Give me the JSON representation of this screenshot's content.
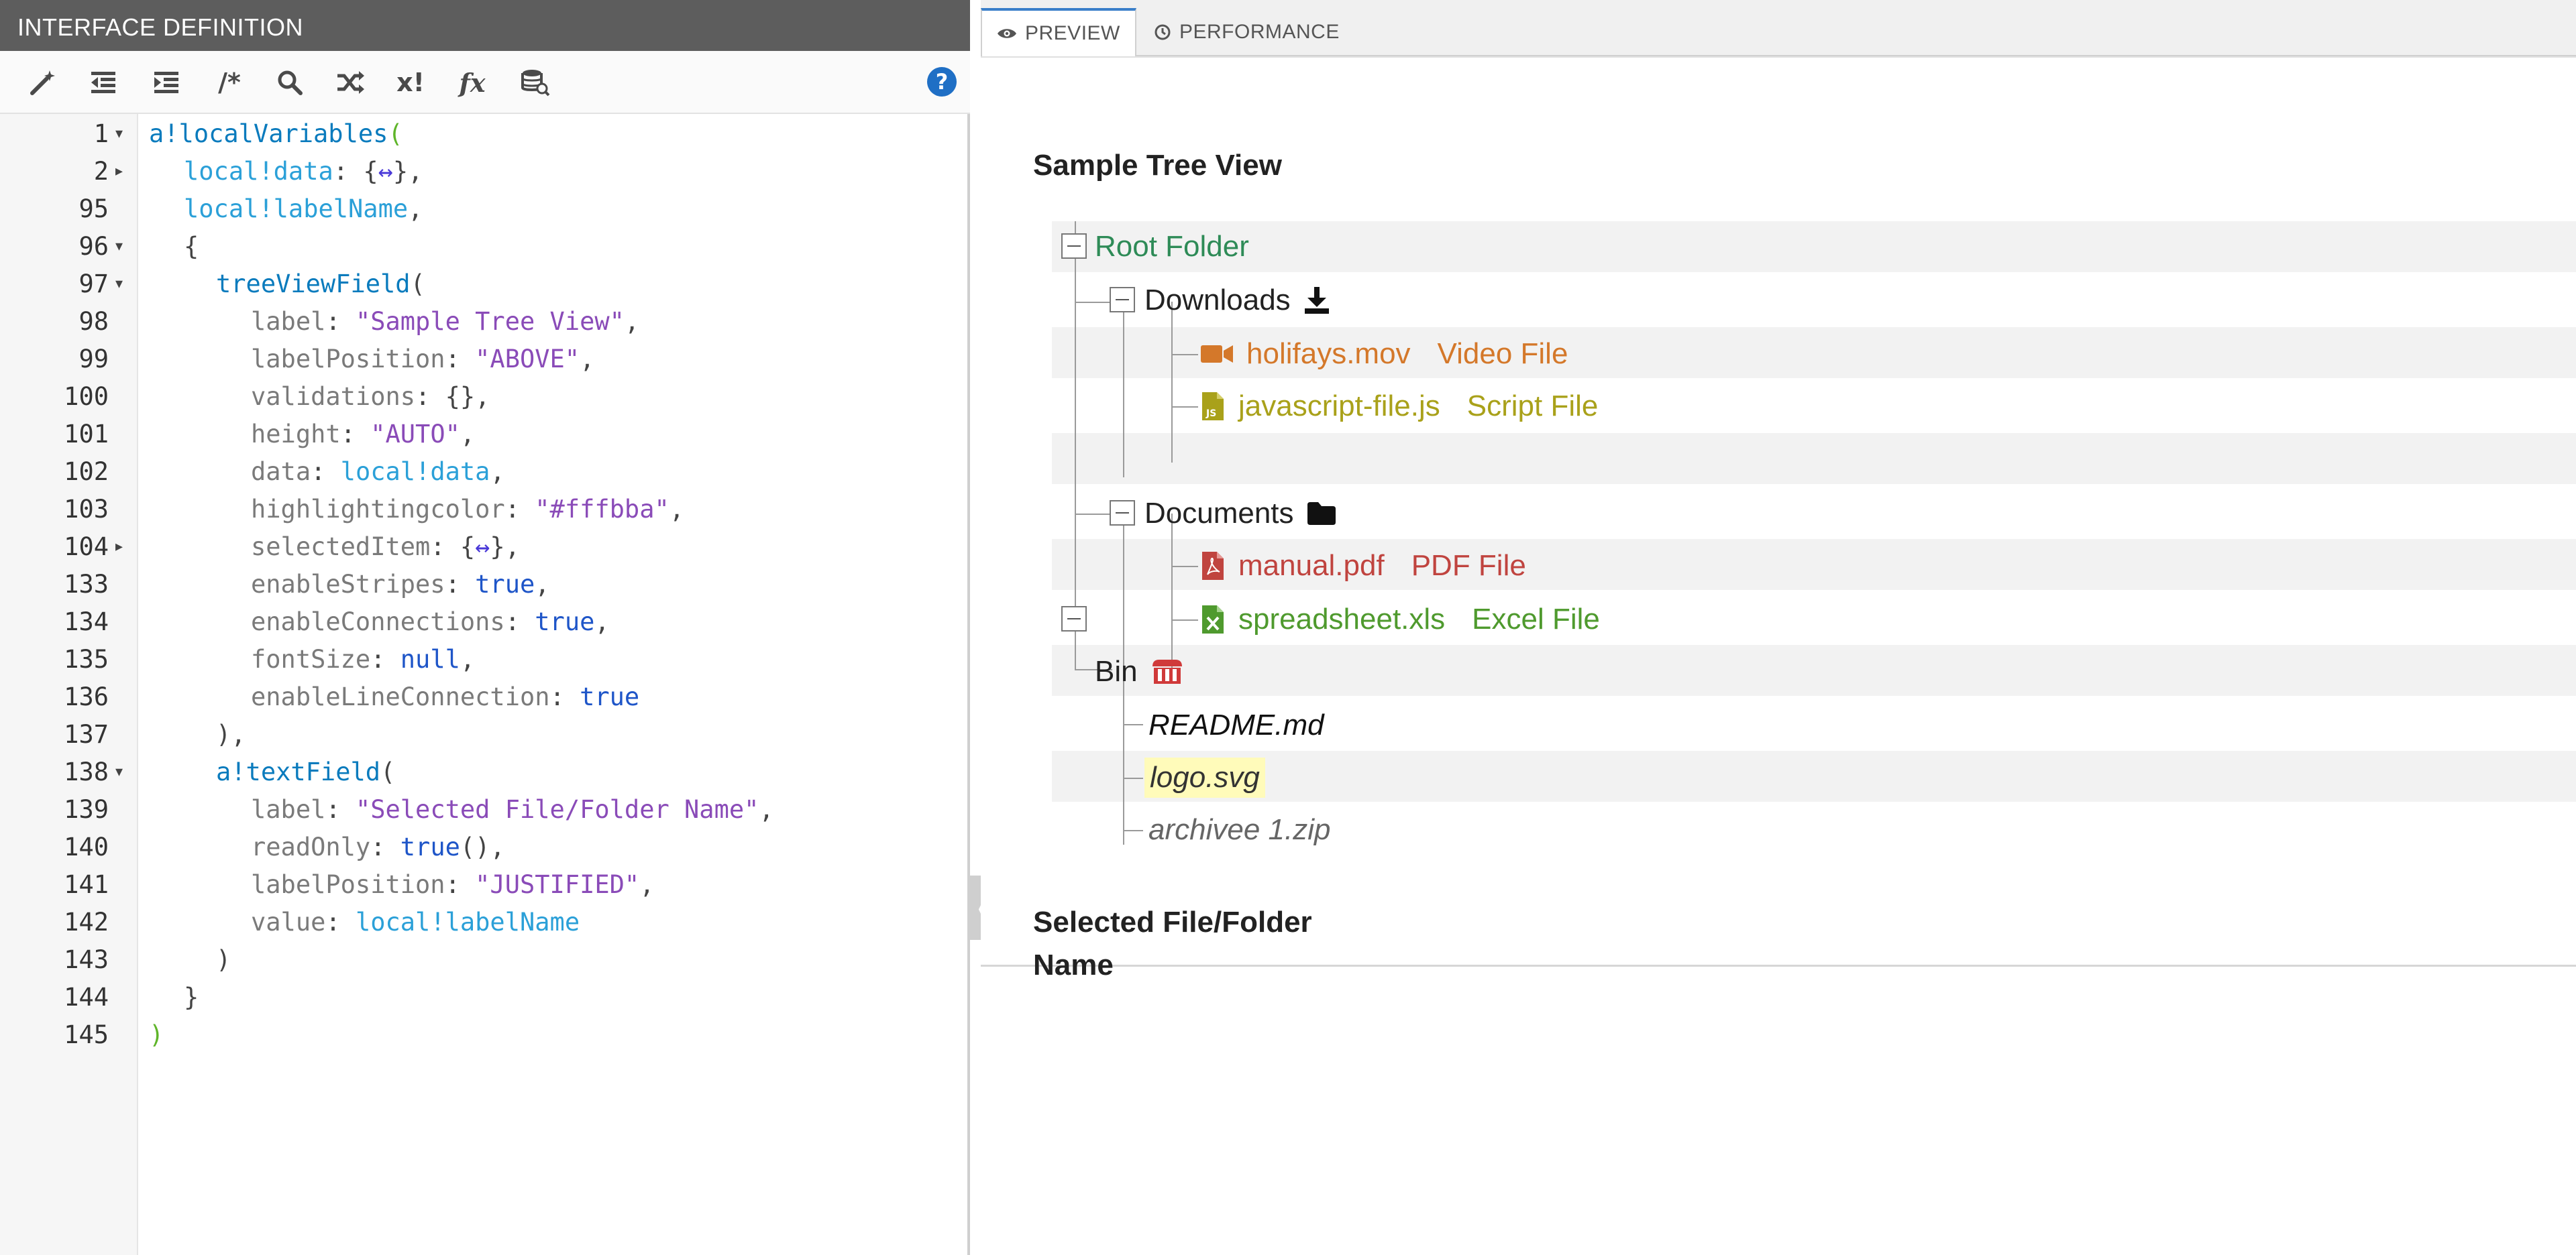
{
  "left": {
    "title": "INTERFACE DEFINITION",
    "toolbar": {
      "comment_label": "/*",
      "random_label": "x!",
      "function_label": "fx",
      "help_label": "?"
    },
    "lines": [
      {
        "num": "1",
        "fold": "▾"
      },
      {
        "num": "2",
        "fold": "▸"
      },
      {
        "num": "95",
        "fold": ""
      },
      {
        "num": "96",
        "fold": "▾"
      },
      {
        "num": "97",
        "fold": "▾"
      },
      {
        "num": "98",
        "fold": ""
      },
      {
        "num": "99",
        "fold": ""
      },
      {
        "num": "100",
        "fold": ""
      },
      {
        "num": "101",
        "fold": ""
      },
      {
        "num": "102",
        "fold": ""
      },
      {
        "num": "103",
        "fold": ""
      },
      {
        "num": "104",
        "fold": "▸"
      },
      {
        "num": "133",
        "fold": ""
      },
      {
        "num": "134",
        "fold": ""
      },
      {
        "num": "135",
        "fold": ""
      },
      {
        "num": "136",
        "fold": ""
      },
      {
        "num": "137",
        "fold": ""
      },
      {
        "num": "138",
        "fold": "▾"
      },
      {
        "num": "139",
        "fold": ""
      },
      {
        "num": "140",
        "fold": ""
      },
      {
        "num": "141",
        "fold": ""
      },
      {
        "num": "142",
        "fold": ""
      },
      {
        "num": "143",
        "fold": ""
      },
      {
        "num": "144",
        "fold": ""
      },
      {
        "num": "145",
        "fold": ""
      }
    ],
    "code": {
      "l1a": "a!localVariables",
      "l1b": "(",
      "l2a": "local!data",
      "l2b": ": {",
      "l2c": "↔",
      "l2d": "},",
      "l95a": "local!labelName",
      "l95b": ",",
      "l96a": "{",
      "l97a": "treeViewField",
      "l97b": "(",
      "l98a": "label",
      "l98b": ": ",
      "l98c": "\"Sample Tree View\"",
      "l98d": ",",
      "l99a": "labelPosition",
      "l99b": ": ",
      "l99c": "\"ABOVE\"",
      "l99d": ",",
      "l100a": "validations",
      "l100b": ": {},",
      "l101a": "height",
      "l101b": ": ",
      "l101c": "\"AUTO\"",
      "l101d": ",",
      "l102a": "data",
      "l102b": ": ",
      "l102c": "local!data",
      "l102d": ",",
      "l103a": "highlightingcolor",
      "l103b": ": ",
      "l103c": "\"#fffbba\"",
      "l103d": ",",
      "l104a": "selectedItem",
      "l104b": ": {",
      "l104c": "↔",
      "l104d": "},",
      "l133a": "enableStripes",
      "l133b": ": ",
      "l133c": "true",
      "l133d": ",",
      "l134a": "enableConnections",
      "l134b": ": ",
      "l134c": "true",
      "l134d": ",",
      "l135a": "fontSize",
      "l135b": ": ",
      "l135c": "null",
      "l135d": ",",
      "l136a": "enableLineConnection",
      "l136b": ": ",
      "l136c": "true",
      "l137a": "),",
      "l138a": "a!textField",
      "l138b": "(",
      "l139a": "label",
      "l139b": ": ",
      "l139c": "\"Selected File/Folder Name\"",
      "l139d": ",",
      "l140a": "readOnly",
      "l140b": ": ",
      "l140c": "true",
      "l140d": "(),",
      "l141a": "labelPosition",
      "l141b": ": ",
      "l141c": "\"JUSTIFIED\"",
      "l141d": ",",
      "l142a": "value",
      "l142b": ": ",
      "l142c": "local!labelName",
      "l143a": ")",
      "l144a": "}",
      "l145a": ")"
    }
  },
  "right": {
    "tabs": [
      {
        "label": "PREVIEW",
        "icon": "eye-icon",
        "active": true
      },
      {
        "label": "PERFORMANCE",
        "icon": "clock-icon",
        "active": false
      }
    ],
    "tree_label": "Sample Tree View",
    "highlight_color": "#fffbba",
    "tree": {
      "root": {
        "name": "Root Folder",
        "color": "#2e8b57"
      },
      "downloads": {
        "name": "Downloads",
        "icon": "download-icon"
      },
      "holifays": {
        "name": "holifays.mov",
        "desc": "Video File",
        "color": "#d4782a",
        "icon": "video-camera-icon"
      },
      "javascript": {
        "name": "javascript-file.js",
        "desc": "Script File",
        "color": "#a9a11a",
        "icon": "js-file-icon"
      },
      "documents": {
        "name": "Documents",
        "icon": "folder-icon"
      },
      "manual": {
        "name": "manual.pdf",
        "desc": "PDF File",
        "color": "#c0443f",
        "icon": "pdf-file-icon"
      },
      "spreadsheet": {
        "name": "spreadsheet.xls",
        "desc": "Excel File",
        "color": "#4f9a2e",
        "icon": "excel-file-icon"
      },
      "bin": {
        "name": "Bin",
        "icon": "bin-icon"
      },
      "readme": {
        "name": "README.md"
      },
      "logo": {
        "name": "logo.svg"
      },
      "archive": {
        "name": "archivee 1.zip"
      }
    },
    "selected_label": "Selected File/Folder Name",
    "selected_value": ""
  }
}
